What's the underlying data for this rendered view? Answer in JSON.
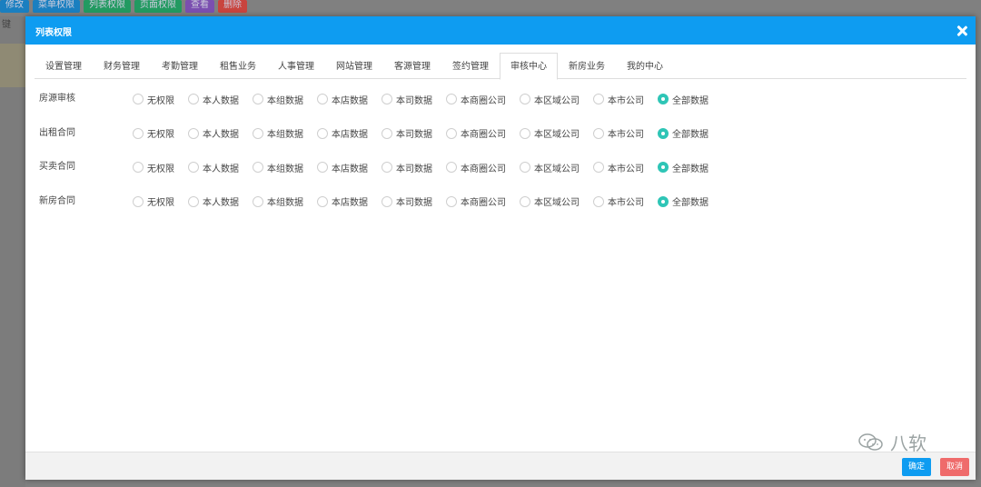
{
  "background": {
    "left_label": "键",
    "toolbar": [
      {
        "label": "修改",
        "color": "#1a7fc0"
      },
      {
        "label": "菜单权限",
        "color": "#1a7fc0"
      },
      {
        "label": "列表权限",
        "color": "#229a61"
      },
      {
        "label": "页面权限",
        "color": "#229a61"
      },
      {
        "label": "查看",
        "color": "#7b4fb0"
      },
      {
        "label": "删除",
        "color": "#c9443e"
      }
    ]
  },
  "modal": {
    "title": "列表权限",
    "tabs": [
      {
        "label": "设置管理",
        "active": false
      },
      {
        "label": "财务管理",
        "active": false
      },
      {
        "label": "考勤管理",
        "active": false
      },
      {
        "label": "租售业务",
        "active": false
      },
      {
        "label": "人事管理",
        "active": false
      },
      {
        "label": "网站管理",
        "active": false
      },
      {
        "label": "客源管理",
        "active": false
      },
      {
        "label": "签约管理",
        "active": false
      },
      {
        "label": "审核中心",
        "active": true
      },
      {
        "label": "新房业务",
        "active": false
      },
      {
        "label": "我的中心",
        "active": false
      }
    ],
    "options": [
      "无权限",
      "本人数据",
      "本组数据",
      "本店数据",
      "本司数据",
      "本商圈公司",
      "本区域公司",
      "本市公司",
      "全部数据"
    ],
    "rows": [
      {
        "label": "房源审核",
        "selected": "全部数据"
      },
      {
        "label": "出租合同",
        "selected": "全部数据"
      },
      {
        "label": "买卖合同",
        "selected": "全部数据"
      },
      {
        "label": "新房合同",
        "selected": "全部数据"
      }
    ],
    "confirm_label": "确定",
    "cancel_label": "取消"
  },
  "watermark": {
    "text": "八软",
    "icon": "wechat-icon"
  },
  "colors": {
    "header": "#0e9cf1",
    "radio_checked": "#2ec5b6",
    "confirm": "#0e9cf1",
    "cancel": "#ef6b6b"
  }
}
